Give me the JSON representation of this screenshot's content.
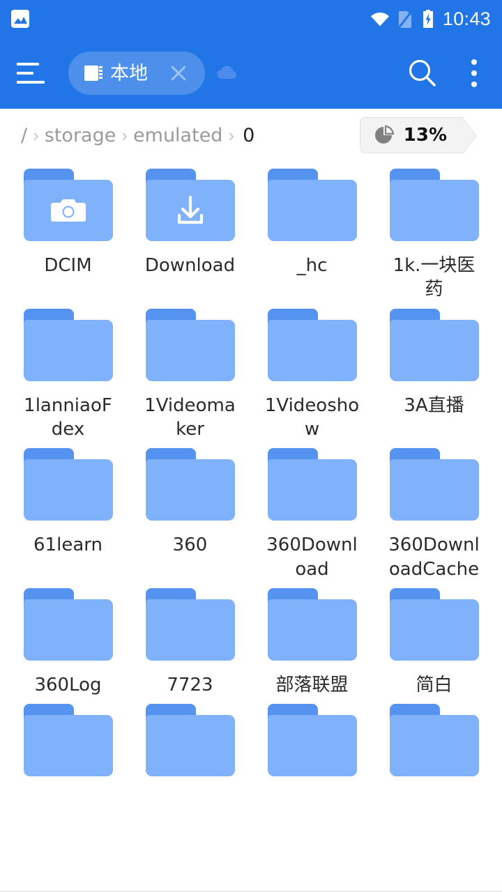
{
  "statusbar": {
    "notification_icon": "image-notification-icon",
    "wifi_icon": "wifi-icon",
    "sim_icon": "no-sim-card-icon",
    "battery_icon": "battery-charging-icon",
    "time": "10:43"
  },
  "appbar": {
    "menu_icon": "hamburger-menu-icon",
    "search_icon": "search-icon",
    "overflow_icon": "overflow-menu-icon",
    "background_color": "#2175E6",
    "tabs": [
      {
        "label": "本地",
        "icon": "sd-card-icon",
        "close_icon": "close-icon",
        "active": true
      },
      {
        "label": "",
        "icon": "cloud-icon",
        "active": false
      }
    ]
  },
  "breadcrumb": {
    "separator": "›",
    "items": [
      {
        "label": "/",
        "current": false
      },
      {
        "label": "storage",
        "current": false
      },
      {
        "label": "emulated",
        "current": false
      },
      {
        "label": "0",
        "current": true
      }
    ],
    "storage_badge": {
      "icon": "pie-chart-icon",
      "percent": "13%"
    }
  },
  "files": [
    {
      "name": "DCIM",
      "type": "folder",
      "glyph": "camera-icon"
    },
    {
      "name": "Download",
      "type": "folder",
      "glyph": "download-icon"
    },
    {
      "name": "_hc",
      "type": "folder",
      "glyph": ""
    },
    {
      "name": "1k.一块医药",
      "type": "folder",
      "glyph": ""
    },
    {
      "name": "1lanniaoFdex",
      "type": "folder",
      "glyph": ""
    },
    {
      "name": "1Videomaker",
      "type": "folder",
      "glyph": ""
    },
    {
      "name": "1Videoshow",
      "type": "folder",
      "glyph": ""
    },
    {
      "name": "3A直播",
      "type": "folder",
      "glyph": ""
    },
    {
      "name": "61learn",
      "type": "folder",
      "glyph": ""
    },
    {
      "name": "360",
      "type": "folder",
      "glyph": ""
    },
    {
      "name": "360Download",
      "type": "folder",
      "glyph": ""
    },
    {
      "name": "360DownloadCache",
      "type": "folder",
      "glyph": ""
    },
    {
      "name": "360Log",
      "type": "folder",
      "glyph": ""
    },
    {
      "name": "7723",
      "type": "folder",
      "glyph": ""
    },
    {
      "name": "部落联盟",
      "type": "folder",
      "glyph": ""
    },
    {
      "name": "简白",
      "type": "folder",
      "glyph": ""
    },
    {
      "name": "",
      "type": "folder",
      "glyph": ""
    },
    {
      "name": "",
      "type": "folder",
      "glyph": ""
    },
    {
      "name": "",
      "type": "folder",
      "glyph": ""
    },
    {
      "name": "",
      "type": "folder",
      "glyph": ""
    }
  ],
  "colors": {
    "appbar": "#2175E6",
    "folder_body": "#7FB2FB",
    "folder_tab": "#5692EF",
    "text_primary": "#2B2B2B",
    "text_muted": "#9A9A9A"
  }
}
